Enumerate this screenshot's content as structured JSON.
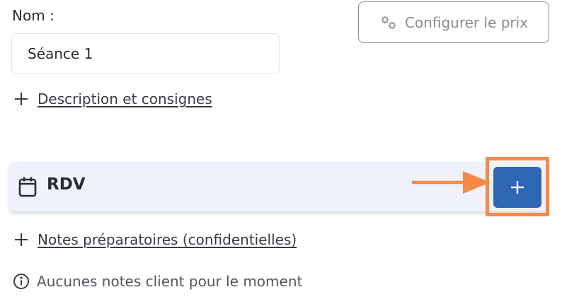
{
  "form": {
    "name_label": "Nom :",
    "name_value": "Séance 1",
    "configure_price_label": "Configurer le prix",
    "add_description_label": "Description et consignes"
  },
  "rdv": {
    "title": "RDV",
    "add_button_symbol": "+"
  },
  "notes": {
    "add_notes_label": "Notes préparatoires (confidentielles)",
    "empty_message": "Aucunes notes client pour le moment"
  },
  "colors": {
    "accent_blue": "#2f66b3",
    "highlight_orange": "#f58a47",
    "bar_background": "#eff2fa"
  },
  "icons": {
    "price": "gears-icon",
    "add": "plus-icon",
    "rdv": "calendar-icon",
    "info": "info-icon"
  }
}
